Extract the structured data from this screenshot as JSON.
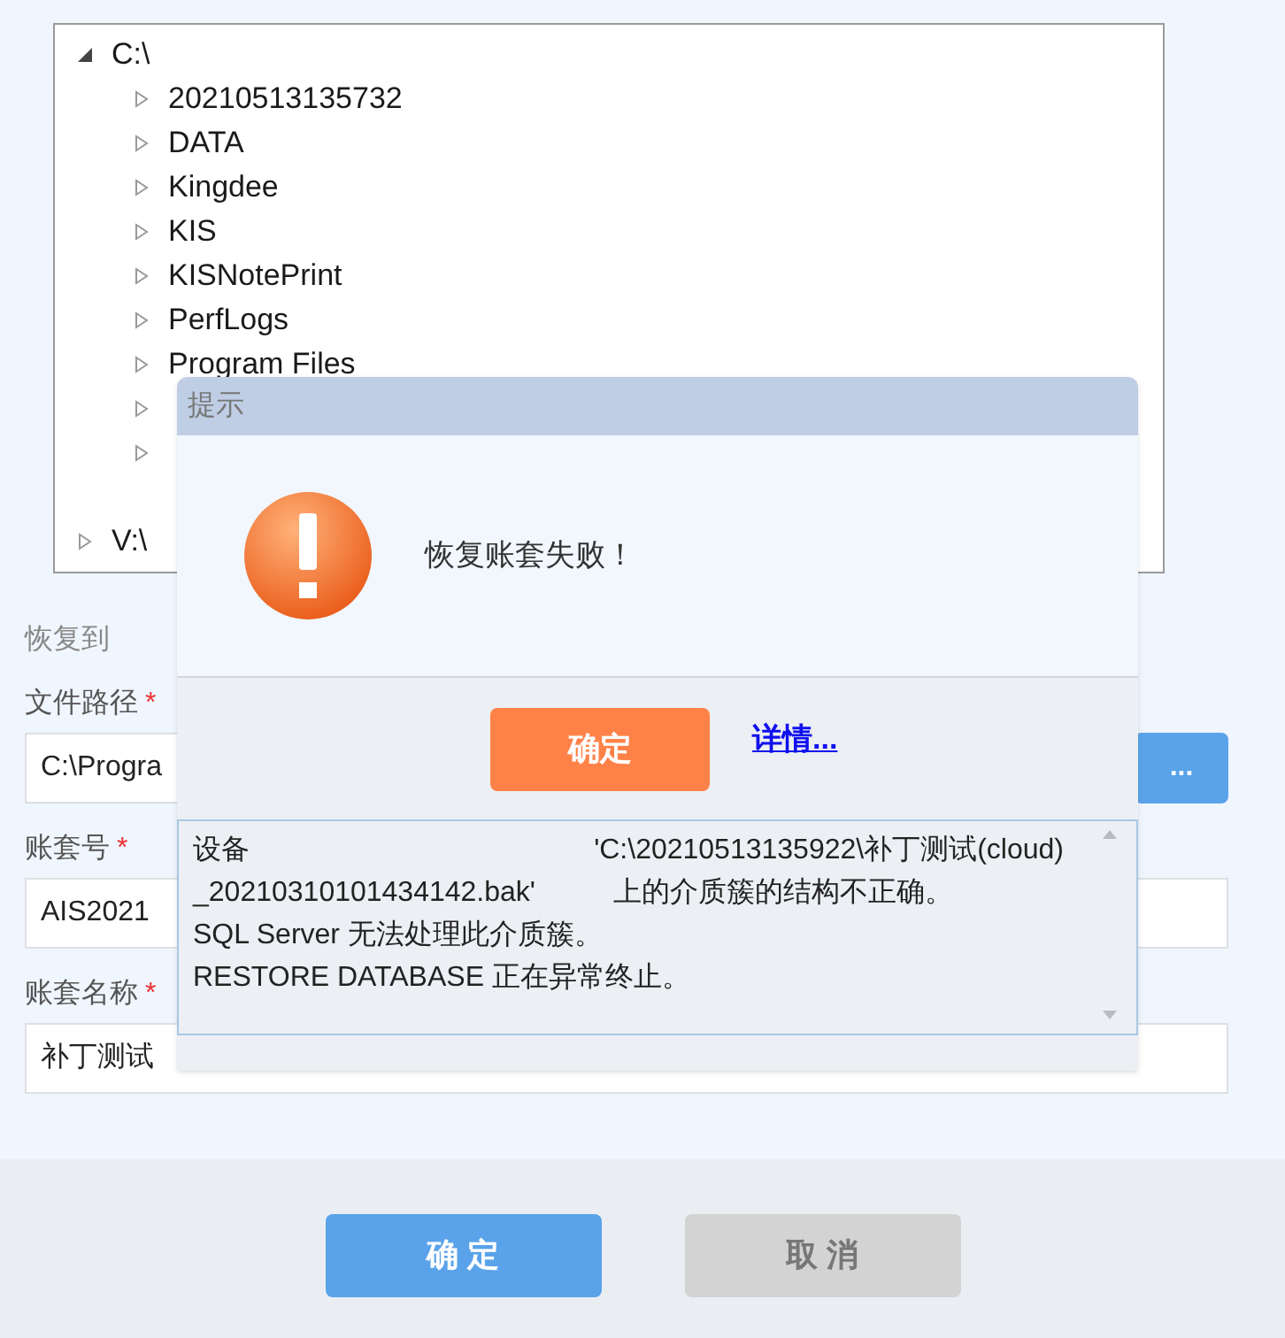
{
  "tree": {
    "label": "C:\\",
    "expanded": true,
    "children": [
      {
        "label": "20210513135732",
        "expanded": false
      },
      {
        "label": "DATA",
        "expanded": false
      },
      {
        "label": "Kingdee",
        "expanded": false
      },
      {
        "label": "KIS",
        "expanded": false
      },
      {
        "label": "KISNotePrint",
        "expanded": false
      },
      {
        "label": "PerfLogs",
        "expanded": false
      },
      {
        "label": "Program Files",
        "expanded": false
      },
      {
        "expanded": false
      },
      {
        "expanded": false
      }
    ],
    "siblings": [
      {
        "label": "V:\\",
        "expanded": false
      }
    ]
  },
  "form": {
    "section": "恢复到",
    "fields": [
      {
        "label": "文件路径",
        "required": "*",
        "value": "C:\\Progra",
        "browse": "..."
      },
      {
        "label": "账套号",
        "required": "*",
        "value": "AIS2021"
      },
      {
        "label": "账套名称",
        "required": "*",
        "value": "补丁测试"
      }
    ]
  },
  "footer": {
    "ok": "确 定",
    "cancel": "取 消"
  },
  "dialog": {
    "title": "提示",
    "message": "恢复账套失败！",
    "ok": "确定",
    "details_link": "详情...",
    "details": [
      [
        "设备",
        "'C:\\20210513135922\\补丁测试(cloud)"
      ],
      [
        "_20210310101434142.bak'",
        "上的介质簇的结构不正确。"
      ],
      [
        "SQL Server 无法处理此介质簇。"
      ],
      [
        "RESTORE DATABASE 正在异常终止。"
      ]
    ]
  }
}
